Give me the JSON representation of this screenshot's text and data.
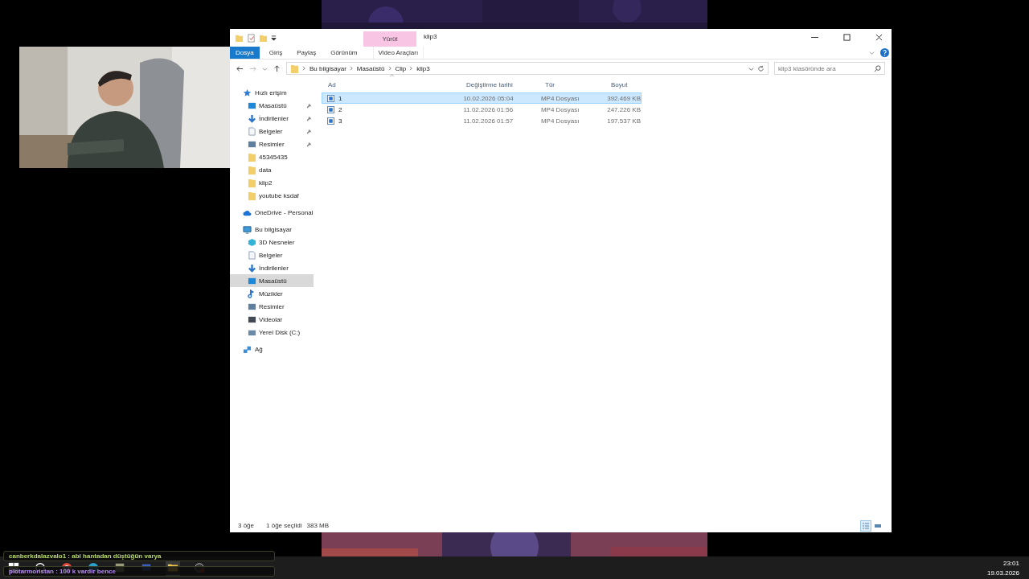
{
  "window": {
    "title": "klip3",
    "context_group": "Yürüt"
  },
  "ribbon_tabs": [
    {
      "label": "Dosya",
      "kind": "file"
    },
    {
      "label": "Giriş",
      "kind": "tab"
    },
    {
      "label": "Paylaş",
      "kind": "tab"
    },
    {
      "label": "Görünüm",
      "kind": "tab"
    },
    {
      "label": "Video Araçları",
      "kind": "context"
    }
  ],
  "address": {
    "path": [
      "Bu bilgisayar",
      "Masaüstü",
      "Clip",
      "klip3"
    ]
  },
  "search": {
    "placeholder": "klip3 klasöründe ara"
  },
  "nav": [
    {
      "label": "Hızlı erişim",
      "kind": "star",
      "children": [
        {
          "label": "Masaüstü",
          "kind": "desktop",
          "pinned": true,
          "selected": false
        },
        {
          "label": "İndirilenler",
          "kind": "download",
          "pinned": true,
          "selected": false
        },
        {
          "label": "Belgeler",
          "kind": "document",
          "pinned": true,
          "selected": false
        },
        {
          "label": "Resimler",
          "kind": "pictures",
          "pinned": true,
          "selected": false
        },
        {
          "label": "45345435",
          "kind": "folder",
          "pinned": false,
          "selected": false
        },
        {
          "label": "data",
          "kind": "folder",
          "pinned": false,
          "selected": false
        },
        {
          "label": "klip2",
          "kind": "folder",
          "pinned": false,
          "selected": false
        },
        {
          "label": "youtube ksdaf",
          "kind": "folder",
          "pinned": false,
          "selected": false
        }
      ]
    },
    {
      "label": "OneDrive - Personal",
      "kind": "cloud"
    },
    {
      "label": "Bu bilgisayar",
      "kind": "pc",
      "children": [
        {
          "label": "3D Nesneler",
          "kind": "cube",
          "pinned": false,
          "selected": false
        },
        {
          "label": "Belgeler",
          "kind": "document",
          "pinned": false,
          "selected": false
        },
        {
          "label": "İndirilenler",
          "kind": "download",
          "pinned": false,
          "selected": false
        },
        {
          "label": "Masaüstü",
          "kind": "desktop",
          "pinned": false,
          "selected": true
        },
        {
          "label": "Müzikler",
          "kind": "music",
          "pinned": false,
          "selected": false
        },
        {
          "label": "Resimler",
          "kind": "pictures",
          "pinned": false,
          "selected": false
        },
        {
          "label": "Videolar",
          "kind": "video",
          "pinned": false,
          "selected": false
        },
        {
          "label": "Yerel Disk (C:)",
          "kind": "disk",
          "pinned": false,
          "selected": false
        }
      ]
    },
    {
      "label": "Ağ",
      "kind": "network"
    }
  ],
  "columns": [
    "Ad",
    "Değiştirme tarihi",
    "Tür",
    "Boyut"
  ],
  "rows": [
    {
      "name": "1",
      "date": "10.02.2026 05:04",
      "type": "MP4 Dosyası",
      "size": "392.469 KB",
      "selected": true
    },
    {
      "name": "2",
      "date": "11.02.2026 01:56",
      "type": "MP4 Dosyası",
      "size": "247.226 KB",
      "selected": false
    },
    {
      "name": "3",
      "date": "11.02.2026 01:57",
      "type": "MP4 Dosyası",
      "size": "197.537 KB",
      "selected": false
    }
  ],
  "status_bar": {
    "count": "3 öğe",
    "selection": "1 öğe seçildi",
    "selection_size": "383 MB"
  },
  "view_buttons": [
    {
      "kind": "details",
      "selected": true
    },
    {
      "kind": "large-icons",
      "selected": false
    }
  ],
  "chat": [
    {
      "text": "canberkdalazvalo1 : abi hantadan düştüğün varya",
      "color": "#b8d86a"
    },
    {
      "text": "plotarmoristan : 100 k vardir bence",
      "color": "#b68cf0"
    }
  ],
  "taskbar": {
    "apps": [
      {
        "kind": "start",
        "selected": false
      },
      {
        "kind": "search",
        "selected": false
      },
      {
        "kind": "chrome",
        "selected": false
      },
      {
        "kind": "edge",
        "selected": false
      },
      {
        "kind": "app",
        "selected": false
      },
      {
        "kind": "monitor",
        "selected": false
      },
      {
        "kind": "explorer",
        "selected": true
      },
      {
        "kind": "clock",
        "selected": false
      }
    ],
    "time": "23:01",
    "date": "19.03.2026"
  }
}
